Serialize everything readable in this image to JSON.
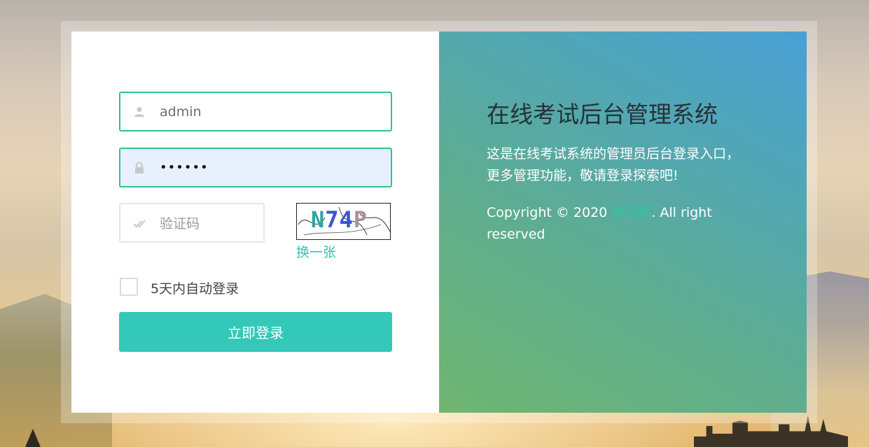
{
  "login_form": {
    "username": {
      "value": "admin"
    },
    "password": {
      "value": "••••••"
    },
    "captcha": {
      "placeholder": "验证码",
      "image_text": "N74P",
      "refresh_label": "换一张"
    },
    "remember_me": {
      "label": "5天内自动登录",
      "checked": false
    },
    "submit_label": "立即登录"
  },
  "info_panel": {
    "title": "在线考试后台管理系统",
    "description": "这是在线考试系统的管理员后台登录入口，更多管理功能，敬请登录探索吧!",
    "copyright_prefix": "Copyright © 2020 ",
    "author": "郭观辉",
    "copyright_suffix": ". All right reserved"
  },
  "colors": {
    "accent": "#33c8b8",
    "input_border": "#2ec28f",
    "gradient_start": "#6fb670",
    "gradient_end": "#4aa0d6"
  },
  "icons": {
    "username": "user-icon",
    "password": "lock-icon",
    "captcha": "double-check-icon"
  }
}
